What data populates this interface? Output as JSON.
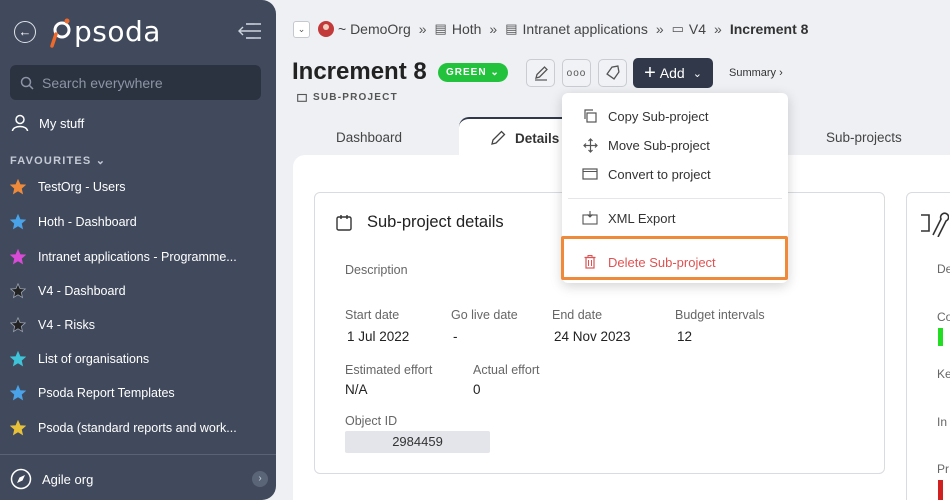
{
  "sidebar": {
    "logo_text": "psoda",
    "search_placeholder": "Search everywhere",
    "my_stuff_label": "My stuff",
    "favourites_title": "FAVOURITES",
    "favourites": [
      {
        "label": "TestOrg - Users",
        "color": "#ef8a3b"
      },
      {
        "label": "Hoth - Dashboard",
        "color": "#4aa3e8"
      },
      {
        "label": "Intranet applications - Programme...",
        "color": "#d94ad6"
      },
      {
        "label": "V4 - Dashboard",
        "color": "#222222"
      },
      {
        "label": "V4 - Risks",
        "color": "#222222"
      },
      {
        "label": "List of organisations",
        "color": "#3ec3d8"
      },
      {
        "label": "Psoda Report Templates",
        "color": "#4aa3e8"
      },
      {
        "label": "Psoda (standard reports and work...",
        "color": "#e8c13a"
      }
    ],
    "org_label": "Agile org"
  },
  "breadcrumb": {
    "items": [
      "~ DemoOrg",
      "Hoth",
      "Intranet applications",
      "V4",
      "Increment 8"
    ]
  },
  "header": {
    "title": "Increment 8",
    "status": "GREEN",
    "add_label": "Add",
    "summary_label": "Summary",
    "type_label": "SUB-PROJECT"
  },
  "tabs": {
    "dashboard": "Dashboard",
    "details": "Details",
    "subprojects": "Sub-projects"
  },
  "details": {
    "card_title": "Sub-project details",
    "description_label": "Description",
    "start_date_label": "Start date",
    "start_date": "1 Jul 2022",
    "go_live_label": "Go live date",
    "go_live": "-",
    "end_date_label": "End date",
    "end_date": "24 Nov 2023",
    "budget_intervals_label": "Budget intervals",
    "budget_intervals": "12",
    "estimated_effort_label": "Estimated effort",
    "estimated_effort": "N/A",
    "actual_effort_label": "Actual effort",
    "actual_effort": "0",
    "object_id_label": "Object ID",
    "object_id": "2984459"
  },
  "side_card_labels": [
    "De",
    "Co",
    "Ke",
    "In",
    "Pr"
  ],
  "menu": {
    "copy": "Copy Sub-project",
    "move": "Move Sub-project",
    "convert": "Convert to project",
    "xml": "XML Export",
    "delete": "Delete Sub-project"
  }
}
